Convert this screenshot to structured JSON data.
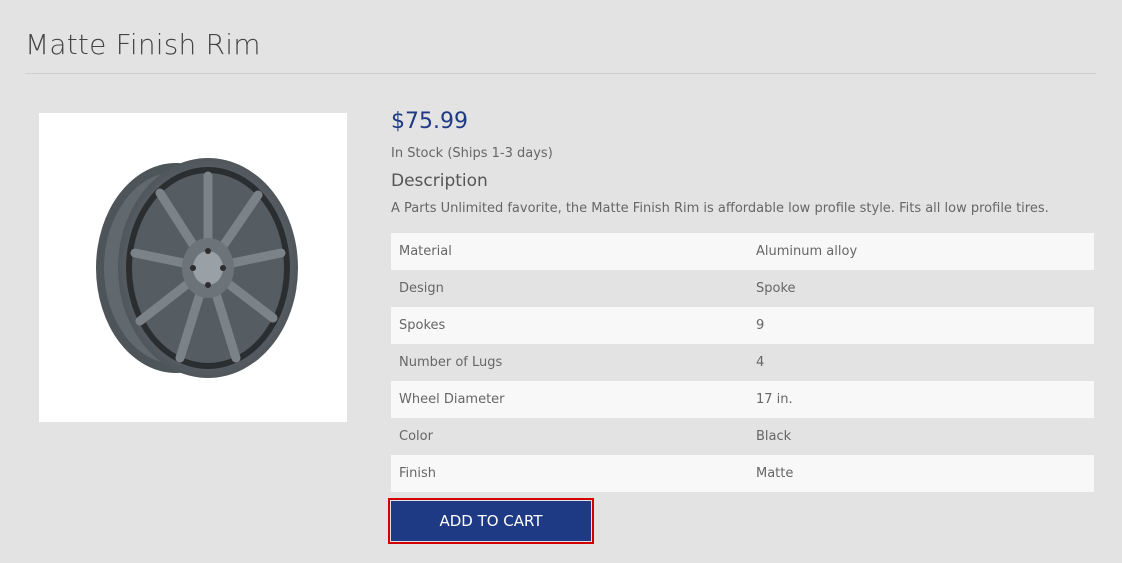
{
  "product": {
    "title": "Matte Finish Rim",
    "price": "$75.99",
    "stock": "In Stock (Ships 1-3 days)",
    "description_heading": "Description",
    "description": "A Parts Unlimited favorite, the Matte Finish Rim is affordable low profile style. Fits all low profile tires."
  },
  "specs": [
    {
      "label": "Material",
      "value": "Aluminum alloy"
    },
    {
      "label": "Design",
      "value": "Spoke"
    },
    {
      "label": "Spokes",
      "value": "9"
    },
    {
      "label": "Number of Lugs",
      "value": "4"
    },
    {
      "label": "Wheel Diameter",
      "value": "17 in."
    },
    {
      "label": "Color",
      "value": "Black"
    },
    {
      "label": "Finish",
      "value": "Matte"
    }
  ],
  "actions": {
    "add_to_cart": "ADD TO CART"
  },
  "colors": {
    "accent": "#1f3a84",
    "focus_outline": "#d40000"
  },
  "image": {
    "icon": "wheel-rim-icon"
  }
}
